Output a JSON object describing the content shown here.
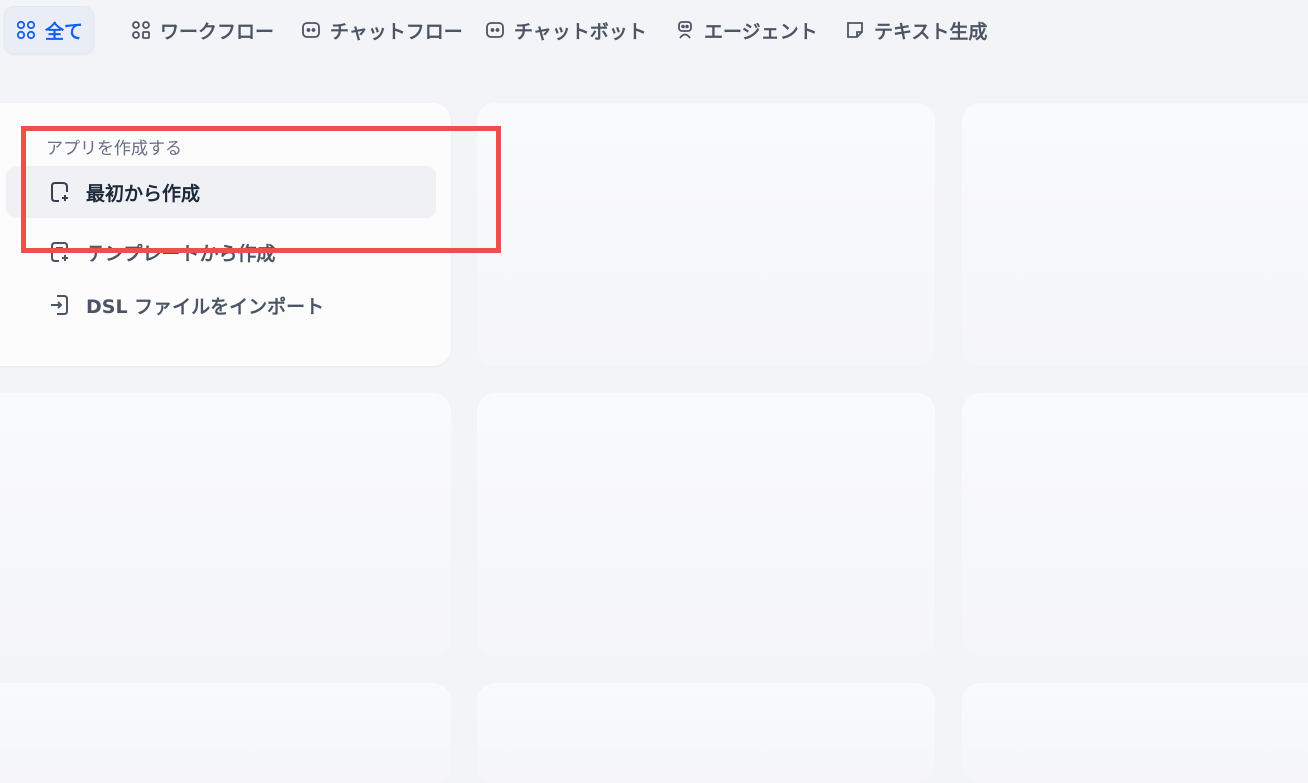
{
  "tabs": [
    {
      "label": "全て",
      "icon": "grid-icon",
      "active": true
    },
    {
      "label": "ワークフロー",
      "icon": "workflow-icon",
      "active": false
    },
    {
      "label": "チャットフロー",
      "icon": "chatflow-icon",
      "active": false
    },
    {
      "label": "チャットボット",
      "icon": "chatbot-icon",
      "active": false
    },
    {
      "label": "エージェント",
      "icon": "agent-icon",
      "active": false
    },
    {
      "label": "テキスト生成",
      "icon": "note-icon",
      "active": false
    }
  ],
  "create_card": {
    "title": "アプリを作成する",
    "items": [
      {
        "label": "最初から作成",
        "icon": "file-plus-icon"
      },
      {
        "label": "テンプレートから作成",
        "icon": "template-icon"
      },
      {
        "label": "DSL ファイルをインポート",
        "icon": "import-icon"
      }
    ]
  },
  "colors": {
    "accent": "#155eef",
    "highlight": "#f04d4d",
    "background": "#f2f4f7"
  }
}
